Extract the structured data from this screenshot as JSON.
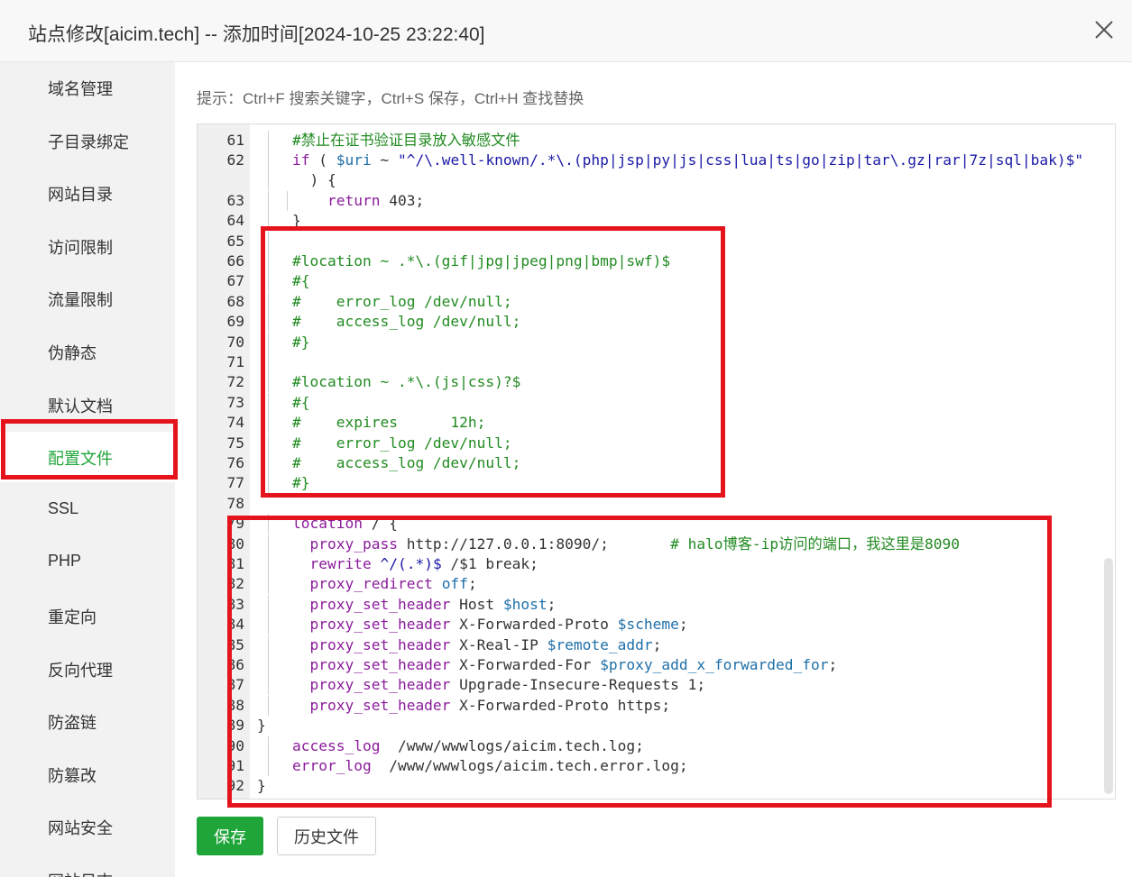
{
  "dialog": {
    "title": "站点修改[aicim.tech] -- 添加时间[2024-10-25 23:22:40]",
    "close_icon": "close-icon"
  },
  "sidebar": {
    "items": [
      {
        "label": "域名管理",
        "active": false
      },
      {
        "label": "子目录绑定",
        "active": false
      },
      {
        "label": "网站目录",
        "active": false
      },
      {
        "label": "访问限制",
        "active": false
      },
      {
        "label": "流量限制",
        "active": false
      },
      {
        "label": "伪静态",
        "active": false
      },
      {
        "label": "默认文档",
        "active": false
      },
      {
        "label": "配置文件",
        "active": true
      },
      {
        "label": "SSL",
        "active": false
      },
      {
        "label": "PHP",
        "active": false
      },
      {
        "label": "重定向",
        "active": false
      },
      {
        "label": "反向代理",
        "active": false
      },
      {
        "label": "防盗链",
        "active": false
      },
      {
        "label": "防篡改",
        "active": false
      },
      {
        "label": "网站安全",
        "active": false
      },
      {
        "label": "网站日志",
        "active": false
      }
    ]
  },
  "hint": "提示：Ctrl+F 搜索关键字，Ctrl+S 保存，Ctrl+H 查找替换",
  "editor": {
    "lines": [
      {
        "n": "61",
        "indent": 1,
        "spans": [
          {
            "c": "c",
            "t": "#禁止在证书验证目录放入敏感文件"
          }
        ]
      },
      {
        "n": "62",
        "indent": 1,
        "spans": [
          {
            "c": "k",
            "t": "if"
          },
          {
            "c": "p",
            "t": " ( "
          },
          {
            "c": "v",
            "t": "$uri"
          },
          {
            "c": "p",
            "t": " ~ "
          },
          {
            "c": "s",
            "t": "\"^/\\.well-known/.*\\.(php|jsp|py|js|css|lua|ts|go|zip|tar\\.gz|rar|7z|sql|bak)$\""
          }
        ]
      },
      {
        "n": "",
        "indent": 1,
        "spans": [
          {
            "c": "p",
            "t": "  ) {"
          }
        ]
      },
      {
        "n": "63",
        "indent": 2,
        "spans": [
          {
            "c": "k",
            "t": "return"
          },
          {
            "c": "p",
            "t": " 403;"
          }
        ]
      },
      {
        "n": "64",
        "indent": 1,
        "spans": [
          {
            "c": "p",
            "t": "}"
          }
        ]
      },
      {
        "n": "65",
        "indent": 1,
        "spans": []
      },
      {
        "n": "66",
        "indent": 1,
        "spans": [
          {
            "c": "c",
            "t": "#location ~ .*\\.(gif|jpg|jpeg|png|bmp|swf)$"
          }
        ]
      },
      {
        "n": "67",
        "indent": 1,
        "spans": [
          {
            "c": "c",
            "t": "#{"
          }
        ]
      },
      {
        "n": "68",
        "indent": 1,
        "spans": [
          {
            "c": "c",
            "t": "#    error_log /dev/null;"
          }
        ]
      },
      {
        "n": "69",
        "indent": 1,
        "spans": [
          {
            "c": "c",
            "t": "#    access_log /dev/null;"
          }
        ]
      },
      {
        "n": "70",
        "indent": 1,
        "spans": [
          {
            "c": "c",
            "t": "#}"
          }
        ]
      },
      {
        "n": "71",
        "indent": 1,
        "spans": []
      },
      {
        "n": "72",
        "indent": 1,
        "spans": [
          {
            "c": "c",
            "t": "#location ~ .*\\.(js|css)?$"
          }
        ]
      },
      {
        "n": "73",
        "indent": 1,
        "spans": [
          {
            "c": "c",
            "t": "#{"
          }
        ]
      },
      {
        "n": "74",
        "indent": 1,
        "spans": [
          {
            "c": "c",
            "t": "#    expires      12h;"
          }
        ]
      },
      {
        "n": "75",
        "indent": 1,
        "spans": [
          {
            "c": "c",
            "t": "#    error_log /dev/null;"
          }
        ]
      },
      {
        "n": "76",
        "indent": 1,
        "spans": [
          {
            "c": "c",
            "t": "#    access_log /dev/null;"
          }
        ]
      },
      {
        "n": "77",
        "indent": 1,
        "spans": [
          {
            "c": "c",
            "t": "#}"
          }
        ]
      },
      {
        "n": "78",
        "indent": 0,
        "spans": []
      },
      {
        "n": "79",
        "indent": 1,
        "spans": [
          {
            "c": "k",
            "t": "location"
          },
          {
            "c": "p",
            "t": " / {"
          }
        ]
      },
      {
        "n": "80",
        "indent": 1,
        "spans": [
          {
            "c": "k",
            "t": "  proxy_pass"
          },
          {
            "c": "p",
            "t": " http://127.0.0.1:8090/;       "
          },
          {
            "c": "c",
            "t": "# halo博客-ip访问的端口，我这里是8090"
          }
        ]
      },
      {
        "n": "81",
        "indent": 1,
        "spans": [
          {
            "c": "k",
            "t": "  rewrite"
          },
          {
            "c": "s",
            "t": " ^/(.*)$"
          },
          {
            "c": "p",
            "t": " /$1 break;"
          }
        ]
      },
      {
        "n": "82",
        "indent": 1,
        "spans": [
          {
            "c": "k",
            "t": "  proxy_redirect"
          },
          {
            "c": "p",
            "t": " "
          },
          {
            "c": "v",
            "t": "off"
          },
          {
            "c": "p",
            "t": ";"
          }
        ]
      },
      {
        "n": "83",
        "indent": 1,
        "spans": [
          {
            "c": "k",
            "t": "  proxy_set_header"
          },
          {
            "c": "p",
            "t": " Host "
          },
          {
            "c": "v",
            "t": "$host"
          },
          {
            "c": "p",
            "t": ";"
          }
        ]
      },
      {
        "n": "84",
        "indent": 1,
        "spans": [
          {
            "c": "k",
            "t": "  proxy_set_header"
          },
          {
            "c": "p",
            "t": " X-Forwarded-Proto "
          },
          {
            "c": "v",
            "t": "$scheme"
          },
          {
            "c": "p",
            "t": ";"
          }
        ]
      },
      {
        "n": "85",
        "indent": 1,
        "spans": [
          {
            "c": "k",
            "t": "  proxy_set_header"
          },
          {
            "c": "p",
            "t": " X-Real-IP "
          },
          {
            "c": "v",
            "t": "$remote_addr"
          },
          {
            "c": "p",
            "t": ";"
          }
        ]
      },
      {
        "n": "86",
        "indent": 1,
        "spans": [
          {
            "c": "k",
            "t": "  proxy_set_header"
          },
          {
            "c": "p",
            "t": " X-Forwarded-For "
          },
          {
            "c": "v",
            "t": "$proxy_add_x_forwarded_for"
          },
          {
            "c": "p",
            "t": ";"
          }
        ]
      },
      {
        "n": "87",
        "indent": 1,
        "spans": [
          {
            "c": "k",
            "t": "  proxy_set_header"
          },
          {
            "c": "p",
            "t": " Upgrade-Insecure-Requests 1;"
          }
        ]
      },
      {
        "n": "88",
        "indent": 1,
        "spans": [
          {
            "c": "k",
            "t": "  proxy_set_header"
          },
          {
            "c": "p",
            "t": " X-Forwarded-Proto https;"
          }
        ]
      },
      {
        "n": "89",
        "indent": 0,
        "spans": [
          {
            "c": "p",
            "t": "}"
          }
        ]
      },
      {
        "n": "90",
        "indent": 1,
        "spans": [
          {
            "c": "k",
            "t": "access_log"
          },
          {
            "c": "p",
            "t": "  /www/wwwlogs/aicim.tech.log;"
          }
        ]
      },
      {
        "n": "91",
        "indent": 1,
        "spans": [
          {
            "c": "k",
            "t": "error_log"
          },
          {
            "c": "p",
            "t": "  /www/wwwlogs/aicim.tech.error.log;"
          }
        ]
      },
      {
        "n": "92",
        "indent": 0,
        "spans": [
          {
            "c": "p",
            "t": "}"
          }
        ]
      }
    ]
  },
  "buttons": {
    "save": "保存",
    "history": "历史文件"
  },
  "colors": {
    "accent": "#20a53a",
    "highlight": "#e5141c",
    "comment": "#228b22",
    "keyword": "#8b1c9b",
    "string": "#1a1aa6",
    "variable": "#1f6fa8"
  }
}
